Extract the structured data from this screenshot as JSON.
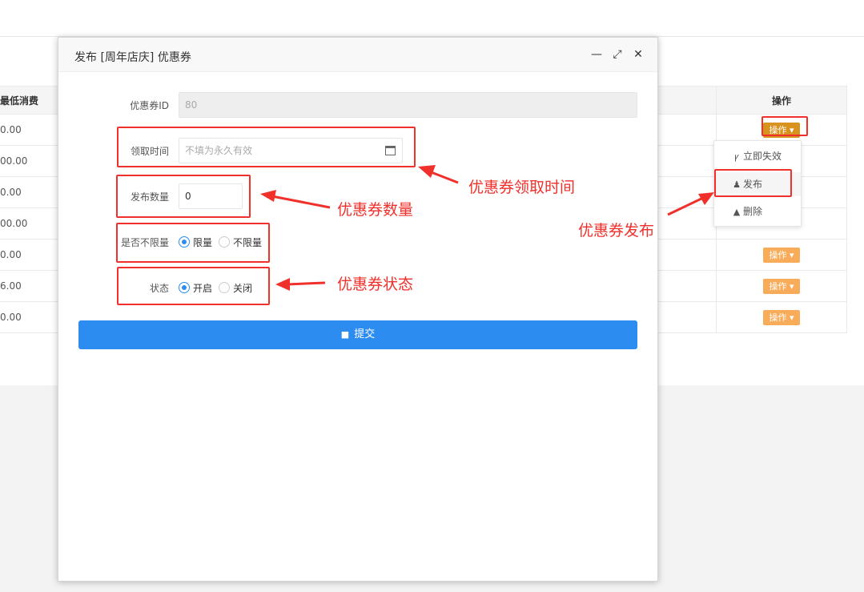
{
  "background_table": {
    "header_min": "最低消费",
    "header_op": "操作",
    "rows": [
      {
        "min": "0.00",
        "op": "操作"
      },
      {
        "min": "00.00",
        "op": ""
      },
      {
        "min": "0.00",
        "op": ""
      },
      {
        "min": "00.00",
        "op": ""
      },
      {
        "min": "0.00",
        "op": "操作"
      },
      {
        "min": "6.00",
        "op": "操作"
      },
      {
        "min": "0.00",
        "op": "操作"
      }
    ]
  },
  "dropdown": {
    "items": [
      {
        "label": "立即失效",
        "icon": "yelp-icon"
      },
      {
        "label": "发布",
        "icon": "male-icon"
      },
      {
        "label": "删除",
        "icon": "warning-icon"
      }
    ]
  },
  "modal": {
    "title": "发布 [周年店庆] 优惠券",
    "minimize": "—",
    "maximize": "⤢",
    "close": "✕",
    "fields": {
      "coupon_id_label": "优惠券ID",
      "coupon_id_value": "80",
      "claim_time_label": "领取时间",
      "claim_time_placeholder": "不填为永久有效",
      "quantity_label": "发布数量",
      "quantity_value": "0",
      "limit_label": "是否不限量",
      "limit_options": [
        "限量",
        "不限量"
      ],
      "limit_selected": "限量",
      "status_label": "状态",
      "status_options": [
        "开启",
        "关闭"
      ],
      "status_selected": "开启"
    },
    "submit_label": "提交"
  },
  "annotations": {
    "claim_time": "优惠券领取时间",
    "quantity": "优惠券数量",
    "status": "优惠券状态",
    "publish": "优惠券发布"
  },
  "colors": {
    "accent": "#2d8cf0",
    "op_button": "#f8ac59",
    "annotation": "#f0302a"
  }
}
